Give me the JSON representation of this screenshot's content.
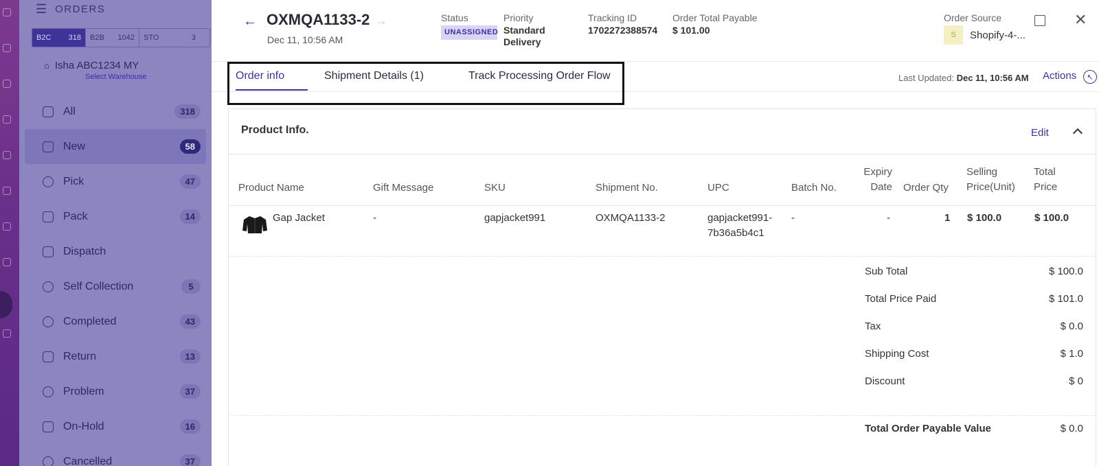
{
  "sidebar": {
    "title": "ORDERS",
    "segments": [
      {
        "label": "B2C",
        "count": "318"
      },
      {
        "label": "B2B",
        "count": "1042"
      },
      {
        "label": "STO",
        "count": "3"
      }
    ],
    "warehouse": {
      "name": "Isha ABC1234 MY",
      "sub": "Select Warehouse"
    },
    "items": [
      {
        "label": "All",
        "count": "318",
        "icon": "monitor-icon"
      },
      {
        "label": "New",
        "count": "58",
        "icon": "document-icon"
      },
      {
        "label": "Pick",
        "count": "47",
        "icon": "pick-icon"
      },
      {
        "label": "Pack",
        "count": "14",
        "icon": "box-icon"
      },
      {
        "label": "Dispatch",
        "count": "",
        "icon": "external-link-icon"
      },
      {
        "label": "Self Collection",
        "count": "5",
        "icon": "compass-icon"
      },
      {
        "label": "Completed",
        "count": "43",
        "icon": "check-circle-icon"
      },
      {
        "label": "Return",
        "count": "13",
        "icon": "return-icon"
      },
      {
        "label": "Problem",
        "count": "37",
        "icon": "alert-circle-icon"
      },
      {
        "label": "On-Hold",
        "count": "16",
        "icon": "stack-icon"
      },
      {
        "label": "Cancelled",
        "count": "37",
        "icon": "x-circle-icon"
      }
    ]
  },
  "order": {
    "id": "OXMQA1133-2",
    "date": "Dec 11, 10:56 AM",
    "status_label": "Status",
    "status_value": "UNASSIGNED",
    "priority_label": "Priority",
    "priority_value": "Standard Delivery",
    "tracking_label": "Tracking ID",
    "tracking_value": "1702272388574",
    "total_label": "Order Total Payable",
    "total_value": "$ 101.00",
    "source_label": "Order Source",
    "source_logo": "S",
    "source_value": "Shopify-4-..."
  },
  "tabs": [
    {
      "label": "Order info"
    },
    {
      "label": "Shipment Details (1)"
    },
    {
      "label": "Track Processing Order Flow"
    }
  ],
  "last_updated": {
    "label": "Last Updated:",
    "value": "Dec 11, 10:56 AM"
  },
  "actions_label": "Actions",
  "product_section": {
    "title": "Product Info.",
    "edit_label": "Edit",
    "columns": {
      "product_name": "Product Name",
      "gift_message": "Gift Message",
      "sku": "SKU",
      "shipment_no": "Shipment No.",
      "upc": "UPC",
      "batch_no": "Batch No.",
      "expiry_l1": "Expiry",
      "expiry_l2": "Date",
      "order_qty": "Order Qty",
      "selling_l1": "Selling",
      "selling_l2": "Price(Unit)",
      "total_l1": "Total",
      "total_l2": "Price"
    },
    "rows": [
      {
        "product_name": "Gap Jacket",
        "gift_message": "-",
        "sku": "gapjacket991",
        "shipment_no": "OXMQA1133-2",
        "upc_l1": "gapjacket991-",
        "upc_l2": "7b36a5b4c1",
        "batch_no": "-",
        "expiry": "-",
        "order_qty": "1",
        "selling_price": "$ 100.0",
        "total_price": "$ 100.0"
      }
    ],
    "summary": [
      {
        "label": "Sub Total",
        "value": "$ 100.0"
      },
      {
        "label": "Total Price Paid",
        "value": "$ 101.0"
      },
      {
        "label": "Tax",
        "value": "$ 0.0"
      },
      {
        "label": "Shipping Cost",
        "value": "$ 1.0"
      },
      {
        "label": "Discount",
        "value": "$ 0"
      }
    ],
    "grand_total": {
      "label": "Total Order Payable Value",
      "value": "$ 0.0"
    }
  },
  "colors": {
    "accent": "#3b34a0",
    "rail": "#6a2f8a",
    "sidebar_overlay": "#8c85bf"
  }
}
